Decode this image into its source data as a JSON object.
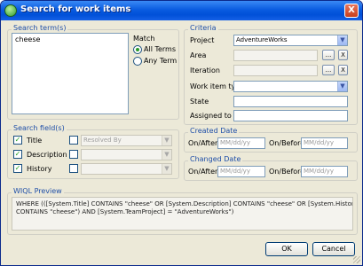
{
  "window": {
    "title": "Search for work items",
    "close_glyph": "X"
  },
  "search_terms": {
    "group_label": "Search term(s)",
    "value": "cheese"
  },
  "match": {
    "label": "Match",
    "options": [
      "All Terms",
      "Any Term"
    ],
    "selected": "All Terms"
  },
  "search_fields": {
    "group_label": "Search field(s)",
    "fields": [
      {
        "label": "Title",
        "checked": true
      },
      {
        "label": "Description",
        "checked": true
      },
      {
        "label": "History",
        "checked": true
      }
    ],
    "extra": [
      {
        "value": "Resolved By",
        "checked": false
      },
      {
        "value": "",
        "checked": false
      },
      {
        "value": "",
        "checked": false
      }
    ]
  },
  "criteria": {
    "group_label": "Criteria",
    "project_label": "Project",
    "project_value": "AdventureWorks",
    "area_label": "Area",
    "iteration_label": "Iteration",
    "work_item_type_label": "Work item type",
    "state_label": "State",
    "assigned_to_label": "Assigned to",
    "browse_glyph": "...",
    "clear_glyph": "X"
  },
  "created_date": {
    "group_label": "Created Date",
    "on_after_label": "On/After",
    "on_before_label": "On/Before",
    "placeholder": "MM/dd/yy"
  },
  "changed_date": {
    "group_label": "Changed Date",
    "on_after_label": "On/After",
    "on_before_label": "On/Before",
    "placeholder": "MM/dd/yy"
  },
  "wiql": {
    "group_label": "WIQL Preview",
    "line1": "WHERE (([System.Title] CONTAINS \"cheese\" OR [System.Description] CONTAINS \"cheese\" OR [System.History]",
    "line2": "CONTAINS \"cheese\") AND [System.TeamProject] = \"AdventureWorks\")"
  },
  "buttons": {
    "ok": "OK",
    "cancel": "Cancel"
  },
  "colors": {
    "titlebar": "#0a5ce0",
    "group_label": "#1f4fa8",
    "dialog_bg": "#ece9d8"
  }
}
